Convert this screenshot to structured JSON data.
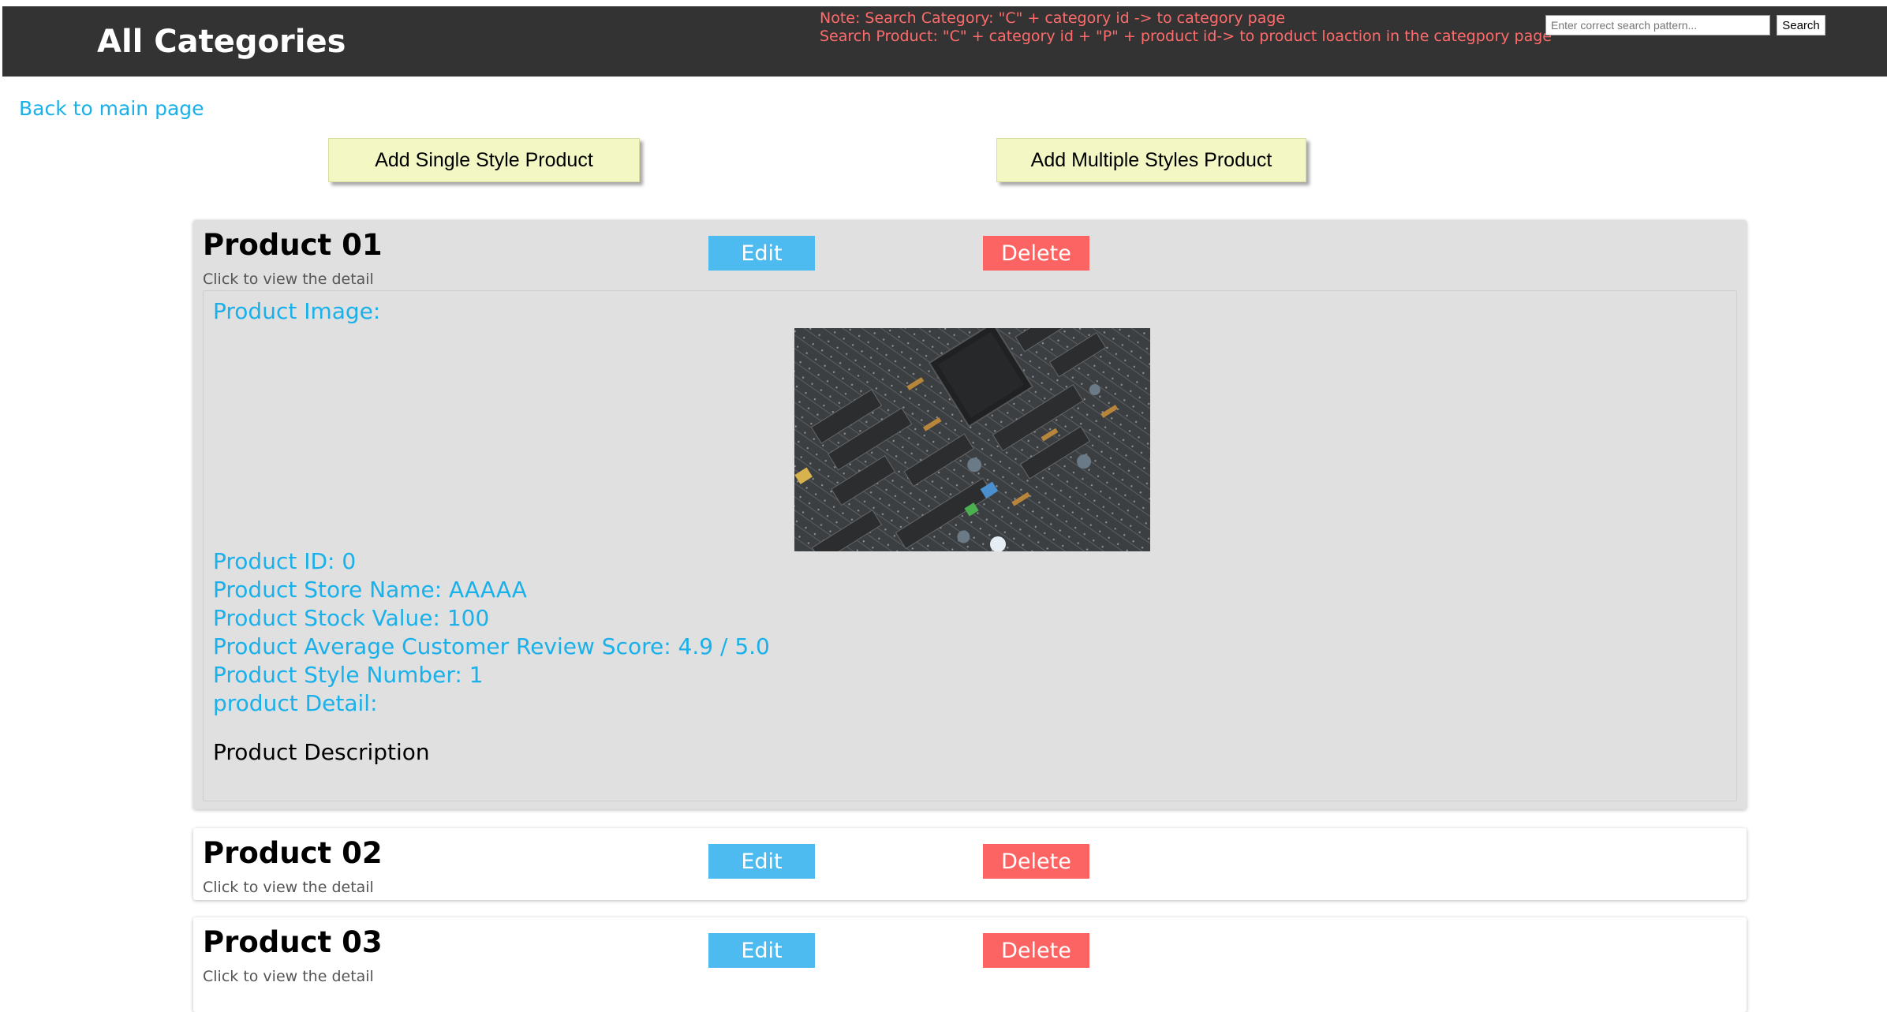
{
  "header": {
    "title": "All Categories",
    "note_line1": "Note: Search Category: \"C\" + category id -> to category page",
    "note_line2": "Search Product: \"C\" + category id + \"P\" + product id-> to product loaction in the categpory page",
    "search_placeholder": "Enter correct search pattern...",
    "search_label": "Search"
  },
  "back_link": "Back to main page",
  "actions": {
    "add_single": "Add Single Style Product",
    "add_multiple": "Add Multiple Styles Product"
  },
  "colors": {
    "header_bg": "#333333",
    "note_text": "#ff6b6b",
    "link_blue": "#1ab0ea",
    "edit_button": "#4dbbf0",
    "delete_button": "#fc6464",
    "add_button": "#f2f7c4",
    "open_card_bg": "#e0e0e0"
  },
  "products": [
    {
      "title": "Product 01",
      "hint": "Click to view the detail",
      "edit_label": "Edit",
      "delete_label": "Delete",
      "details": {
        "image_label": "Product Image:",
        "id": "Product ID: 0",
        "store": "Product Store Name: AAAAA",
        "stock": "Product Stock Value: 100",
        "review": "Product Average Customer Review Score: 4.9 / 5.0",
        "style_number": "Product Style Number: 1",
        "detail_label": "product Detail:",
        "description": "Product Description"
      }
    },
    {
      "title": "Product 02",
      "hint": "Click to view the detail",
      "edit_label": "Edit",
      "delete_label": "Delete"
    },
    {
      "title": "Product 03",
      "hint": "Click to view the detail",
      "edit_label": "Edit",
      "delete_label": "Delete"
    }
  ]
}
